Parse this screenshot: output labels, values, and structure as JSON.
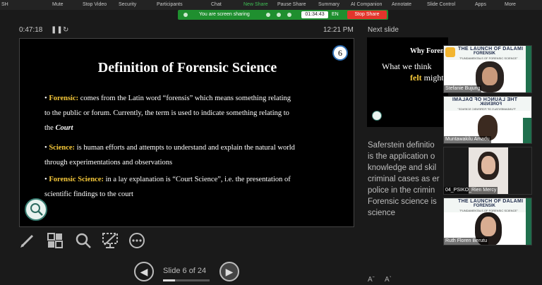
{
  "toolbar": {
    "items": [
      {
        "label": "Mute",
        "x": "left"
      },
      {
        "label": "Stop Video"
      },
      {
        "label": "Security"
      },
      {
        "label": "Participants"
      },
      {
        "label": "Chat"
      },
      {
        "label": "New Share"
      },
      {
        "label": "Pause Share"
      },
      {
        "label": "Summary"
      },
      {
        "label": "AI Companion"
      },
      {
        "label": "Annotate"
      },
      {
        "label": "Slide Control"
      },
      {
        "label": "Apps"
      },
      {
        "label": "More"
      }
    ],
    "partial_label": "SH"
  },
  "share_bar": {
    "status": "You are screen sharing",
    "timer": "01:34:43",
    "language": "EN",
    "stop_label": "Stop Share",
    "accent": "#1f8f2f",
    "stop_color": "#e3352b"
  },
  "presenter": {
    "elapsed": "0:47:18",
    "clock": "12:21 PM",
    "next_slide_label": "Next slide",
    "slide_counter": "Slide 6 of 24",
    "progress": 0.25
  },
  "slide": {
    "title": "Definition of Forensic Science",
    "number": "6",
    "bullets": [
      {
        "term": "Forensic:",
        "text": " comes from the Latin word “forensis” which means something relating",
        "line2": "to the public or forum. Currently, the term is used to indicate something relating to",
        "line3": "the",
        "line3_em": "Court"
      },
      {
        "term": "Science:",
        "text": " is human efforts and attempts to understand and explain the natural world",
        "line2": "through experimentations and observations"
      },
      {
        "term": "Forensic Science:",
        "text": " in a lay explanation is “Court Science”, i.e. the presentation of",
        "line2": "scientific findings to the court"
      }
    ]
  },
  "next_preview": {
    "title": "Why Foren",
    "line1": "What we think",
    "line2_em": "felt",
    "line2_rest": " might"
  },
  "notes": [
    "Saferstein definitio",
    "is the application o",
    "knowledge and skil",
    "criminal cases as er",
    "police in the crimin",
    "Forensic science is",
    "science"
  ],
  "videos": [
    {
      "name": "Stefanie Bujung",
      "banner1": "THE LAUNCH OF DALAMI",
      "banner2": "FORENSIK",
      "banner3": "\"FUNDAMENTALS OF FORENSIC SCIENCE\""
    },
    {
      "name": "Muntawakilu Amadu",
      "banner1": "THE LAUNCH OF DALAMI",
      "banner2": "FORENSIK",
      "banner3": "\"FUNDAMENTALS OF FORENSIC SCIENCE\""
    },
    {
      "name": "04_PSIKO_Rien Mercy"
    },
    {
      "name": "Ruth Floren Berutu",
      "banner1": "THE LAUNCH OF DALAMI",
      "banner2": "FORENSIK",
      "banner3": "\"FUNDAMENTALS OF FORENSIC SCIENCE\""
    }
  ]
}
